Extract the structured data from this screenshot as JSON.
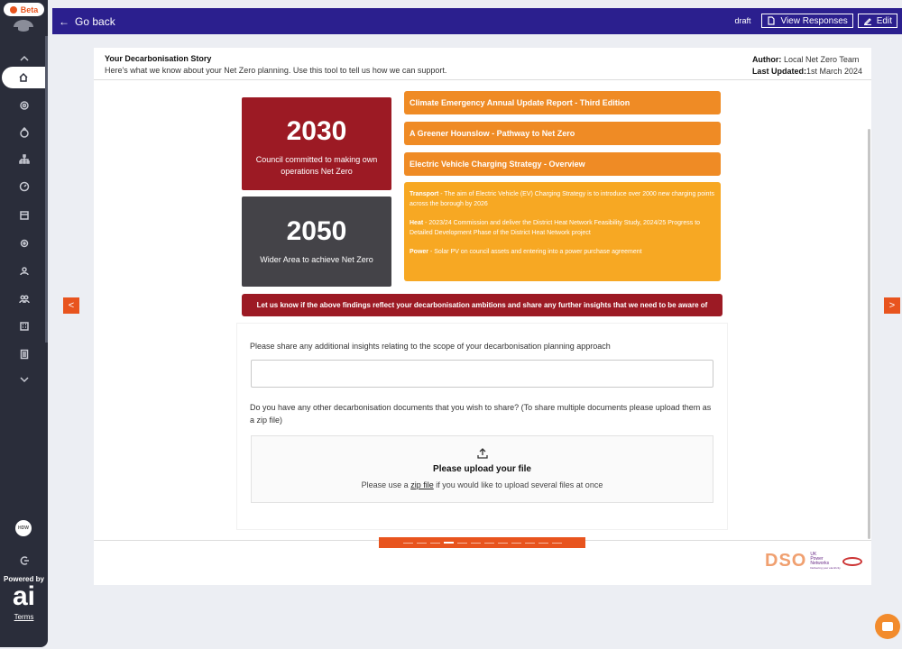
{
  "sidebar": {
    "beta_label": "Beta",
    "avatar_initials": "HDW",
    "powered_by": "Powered by",
    "ai_logo": "ai",
    "terms": "Terms"
  },
  "topbar": {
    "go_back": "Go back",
    "status": "draft",
    "view_responses": "View Responses",
    "edit": "Edit"
  },
  "header": {
    "title": "Your Decarbonisation Story",
    "subtitle": "Here's what we know about your Net Zero planning. Use this tool to tell us how we can support.",
    "author_label": "Author:",
    "author_value": "Local Net Zero Team",
    "updated_label": "Last Updated:",
    "updated_value": "1st March 2024"
  },
  "targets": [
    {
      "year": "2030",
      "description": "Council committed to making own operations Net Zero"
    },
    {
      "year": "2050",
      "description": "Wider Area to achieve Net Zero"
    }
  ],
  "documents": [
    "Climate Emergency Annual Update Report - Third Edition",
    "A Greener Hounslow - Pathway to Net Zero",
    "Electric Vehicle Charging Strategy - Overview"
  ],
  "insights": [
    {
      "label": "Transport",
      "text": " - The aim of Electric Vehicle (EV) Charging Strategy is to introduce over 2000 new charging points across the borough by 2026"
    },
    {
      "label": "Heat",
      "text": " - 2023/24 Commission and deliver the District Heat Network Feasibility Study, 2024/25 Progress to Detailed Development Phase of the District Heat Network project"
    },
    {
      "label": "Power",
      "text": " - Solar PV on council assets and entering into a power purchase agreement"
    }
  ],
  "banner": "Let us know if the above findings reflect your decarbonisation ambitions and share any further insights that we need to be aware of",
  "form": {
    "q1": "Please share any additional insights relating to the scope of your decarbonisation planning approach",
    "q1_value": "",
    "q2": "Do you have any other decarbonisation documents that you wish to share? (To share multiple documents please upload them as a zip file)",
    "upload_title": "Please upload your file",
    "upload_pre": "Please use a ",
    "upload_link": "zip file",
    "upload_post": " if you would like to upload several files at once"
  },
  "pager": {
    "total": 12,
    "current": 4
  },
  "footer": {
    "dso": "DSO",
    "ukpn_1": "UK",
    "ukpn_2": "Power",
    "ukpn_3": "Networks",
    "ukpn_4": "Delivering your electricity"
  },
  "colors": {
    "brand_navy": "#2b1f8e",
    "accent_orange": "#e8541e",
    "target_red": "#9c1a24",
    "doc_orange": "#ef8b25",
    "info_yellow": "#f7a823"
  }
}
